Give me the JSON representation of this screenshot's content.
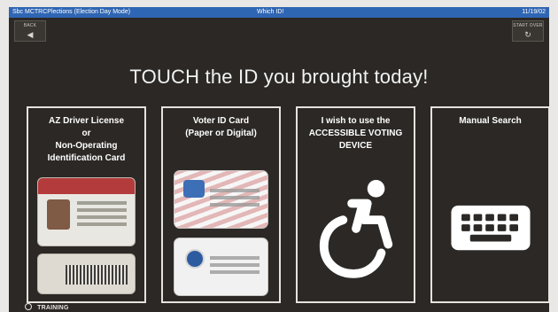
{
  "window": {
    "title_left": "Sbc MCTRCPlections (Election Day Mode)",
    "title_center": "Which ID!",
    "title_right": "11/19/02"
  },
  "toolbar": {
    "back_caption": "BACK",
    "right_caption": "START OVER",
    "back_icon": "left-arrow-icon",
    "right_icon": "refresh-icon"
  },
  "headline": "TOUCH the ID you brought today!",
  "cards": [
    {
      "id": "az-driver-license",
      "title": "AZ Driver License\nor\nNon-Operating\nIdentification Card"
    },
    {
      "id": "voter-id-card",
      "title": "Voter ID Card\n(Paper or Digital)"
    },
    {
      "id": "accessible-voting-device",
      "title": "I wish to use the\nACCESSIBLE VOTING\nDEVICE"
    },
    {
      "id": "manual-search",
      "title": "Manual Search"
    }
  ],
  "footer": {
    "training_label": "TRAINING"
  },
  "colors": {
    "titlebar": "#2f66b3",
    "background": "#2b2825",
    "card_border": "#e6e3dd",
    "text": "#ffffff"
  }
}
